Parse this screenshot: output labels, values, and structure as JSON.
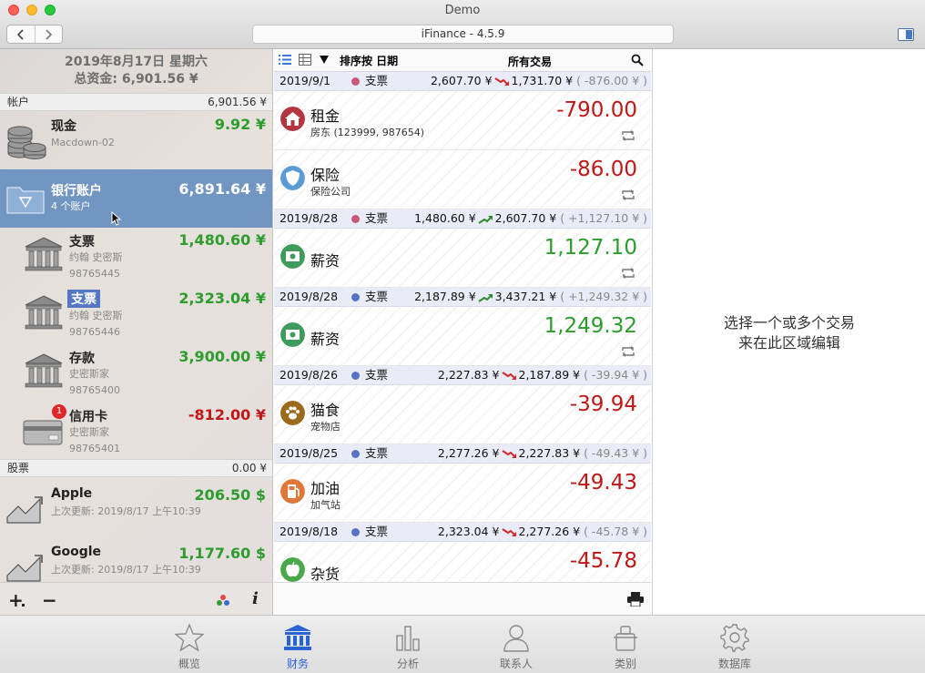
{
  "window": {
    "title": "Demo",
    "address": "iFinance - 4.5.9"
  },
  "summary": {
    "date_line": "2019年8月17日 星期六",
    "total_line": "总资金: 6,901.56 ¥"
  },
  "accounts_section": {
    "label": "帐户",
    "amount": "6,901.56 ¥"
  },
  "accounts": [
    {
      "name": "现金",
      "sub": "Macdown-02",
      "sub2": "",
      "balance": "9.92 ¥",
      "icon": "coins-icon",
      "color": "green"
    },
    {
      "name": "银行账户",
      "sub": "4 个账户",
      "sub2": "",
      "balance": "6,891.64 ¥",
      "icon": "folder-icon",
      "color": "white"
    },
    {
      "name": "支票",
      "sub": "约翰 史密斯",
      "sub2": "98765445",
      "balance": "1,480.60 ¥",
      "icon": "bank-icon",
      "color": "green"
    },
    {
      "name": "支票",
      "sub": "约翰 史密斯",
      "sub2": "98765446",
      "balance": "2,323.04 ¥",
      "icon": "bank-icon",
      "color": "green"
    },
    {
      "name": "存款",
      "sub": "史密斯家",
      "sub2": "98765400",
      "balance": "3,900.00 ¥",
      "icon": "bank-icon",
      "color": "green"
    },
    {
      "name": "信用卡",
      "sub": "史密斯家",
      "sub2": "98765401",
      "balance": "-812.00 ¥",
      "icon": "credit-card-icon",
      "color": "red",
      "badge": "1"
    }
  ],
  "stocks_section": {
    "label": "股票",
    "amount": "0.00 ¥"
  },
  "stocks": [
    {
      "name": "Apple",
      "updated": "上次更新: 2019/8/17 上午10:39",
      "value": "206.50 $"
    },
    {
      "name": "Google",
      "updated": "上次更新: 2019/8/17 上午10:39",
      "value": "1,177.60 $"
    }
  ],
  "left_footer": {
    "add": "+",
    "remove": "−",
    "info": "i"
  },
  "toolbar": {
    "sort_label": "排序按 日期",
    "filter_label": "所有交易"
  },
  "days": [
    {
      "date": "2019/9/1",
      "dot": "#c8577a",
      "account": "支票",
      "from": "2,607.70 ¥",
      "to": "1,731.70 ¥",
      "delta": "( -876.00 ¥ )",
      "dir": "down",
      "txns": [
        {
          "name": "租金",
          "sub": "房东 (123999, 987654)",
          "amount": "-790.00",
          "icon": "house-icon",
          "icon_color": "#b3353f",
          "color": "red",
          "repeat": true
        },
        {
          "name": "保险",
          "sub": "保险公司",
          "amount": "-86.00",
          "icon": "shield-icon",
          "icon_color": "#5b9bd5",
          "color": "red",
          "repeat": true
        }
      ]
    },
    {
      "date": "2019/8/28",
      "dot": "#c8577a",
      "account": "支票",
      "from": "1,480.60 ¥",
      "to": "2,607.70 ¥",
      "delta": "( +1,127.10 ¥ )",
      "dir": "up",
      "txns": [
        {
          "name": "薪资",
          "sub": "",
          "amount": "1,127.10",
          "icon": "money-icon",
          "icon_color": "#3f9b5c",
          "color": "green",
          "repeat": true
        }
      ]
    },
    {
      "date": "2019/8/28",
      "dot": "#5872c6",
      "account": "支票",
      "from": "2,187.89 ¥",
      "to": "3,437.21 ¥",
      "delta": "( +1,249.32 ¥ )",
      "dir": "up",
      "txns": [
        {
          "name": "薪资",
          "sub": "",
          "amount": "1,249.32",
          "icon": "money-icon",
          "icon_color": "#3f9b5c",
          "color": "green",
          "repeat": true
        }
      ]
    },
    {
      "date": "2019/8/26",
      "dot": "#5872c6",
      "account": "支票",
      "from": "2,227.83 ¥",
      "to": "2,187.89 ¥",
      "delta": "( -39.94 ¥ )",
      "dir": "down",
      "txns": [
        {
          "name": "猫食",
          "sub": "宠物店",
          "amount": "-39.94",
          "icon": "paw-icon",
          "icon_color": "#9b6a1c",
          "color": "red",
          "repeat": false
        }
      ]
    },
    {
      "date": "2019/8/25",
      "dot": "#5872c6",
      "account": "支票",
      "from": "2,277.26 ¥",
      "to": "2,227.83 ¥",
      "delta": "( -49.43 ¥ )",
      "dir": "down",
      "txns": [
        {
          "name": "加油",
          "sub": "加气站",
          "amount": "-49.43",
          "icon": "fuel-icon",
          "icon_color": "#e0773a",
          "color": "red",
          "repeat": false
        }
      ]
    },
    {
      "date": "2019/8/18",
      "dot": "#5872c6",
      "account": "支票",
      "from": "2,323.04 ¥",
      "to": "2,277.26 ¥",
      "delta": "( -45.78 ¥ )",
      "dir": "down",
      "txns": [
        {
          "name": "杂货",
          "sub": "",
          "amount": "-45.78",
          "icon": "apple-icon",
          "icon_color": "#4aa84a",
          "color": "red",
          "repeat": false
        }
      ]
    }
  ],
  "right_hint": {
    "line1": "选择一个或多个交易",
    "line2": "来在此区域编辑"
  },
  "tabs": [
    {
      "label": "概览",
      "icon": "star-icon",
      "active": false
    },
    {
      "label": "财务",
      "icon": "bank-icon",
      "active": true
    },
    {
      "label": "分析",
      "icon": "bar-chart-icon",
      "active": false
    },
    {
      "label": "联系人",
      "icon": "person-icon",
      "active": false
    },
    {
      "label": "类别",
      "icon": "category-icon",
      "active": false
    },
    {
      "label": "数据库",
      "icon": "gear-icon",
      "active": false
    }
  ],
  "colors": {
    "green": "#2c9c2c",
    "red": "#c01818",
    "selected_row": "#7296c2",
    "active_tab": "#2a63d4"
  }
}
